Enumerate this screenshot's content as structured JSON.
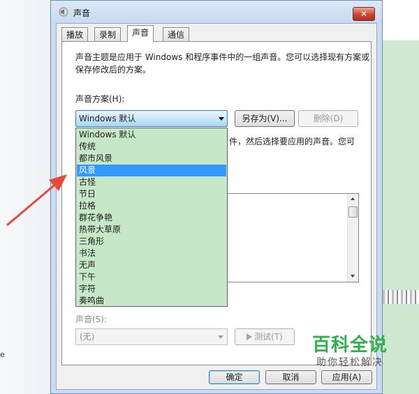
{
  "background": {
    "left_text": "e"
  },
  "dialog": {
    "title": "声音",
    "close_label": "✕",
    "tabs": [
      {
        "label": "播放"
      },
      {
        "label": "录制"
      },
      {
        "label": "声音"
      },
      {
        "label": "通信"
      }
    ],
    "active_tab": "声音",
    "description": "声音主题是应用于 Windows 和程序事件中的一组声音。您可以选择现有方案或保存修改后的方案。",
    "scheme_label": "声音方案(H):",
    "scheme_combo": {
      "value": "Windows 默认"
    },
    "buttons": {
      "save_as": "另存为(V)...",
      "delete": "删除(D)",
      "ok": "确定",
      "cancel": "取消",
      "apply": "应用(A)",
      "test": "测试(T)"
    },
    "partial_text": "件，然后选择要应用的声音。您可",
    "dropdown_items": [
      {
        "label": "Windows 默认"
      },
      {
        "label": "传统"
      },
      {
        "label": "都市风景"
      },
      {
        "label": "风景"
      },
      {
        "label": "古怪"
      },
      {
        "label": "节日"
      },
      {
        "label": "拉格"
      },
      {
        "label": "群花争艳"
      },
      {
        "label": "热带大草原"
      },
      {
        "label": "三角形"
      },
      {
        "label": "书法"
      },
      {
        "label": "无声"
      },
      {
        "label": "下午"
      },
      {
        "label": "字符"
      },
      {
        "label": "奏鸣曲"
      }
    ],
    "selected_item": "风景",
    "sound_label": "声音(S):",
    "sound_combo": {
      "value": "(无)"
    }
  },
  "watermark": {
    "title": "百科全说",
    "subtitle": "助你轻松解决"
  },
  "colors": {
    "dropdown_bg": "#c6e8c8",
    "selection": "#3399ff",
    "annotation_arrow": "#e8473b",
    "watermark_green": "#2fb04a"
  }
}
